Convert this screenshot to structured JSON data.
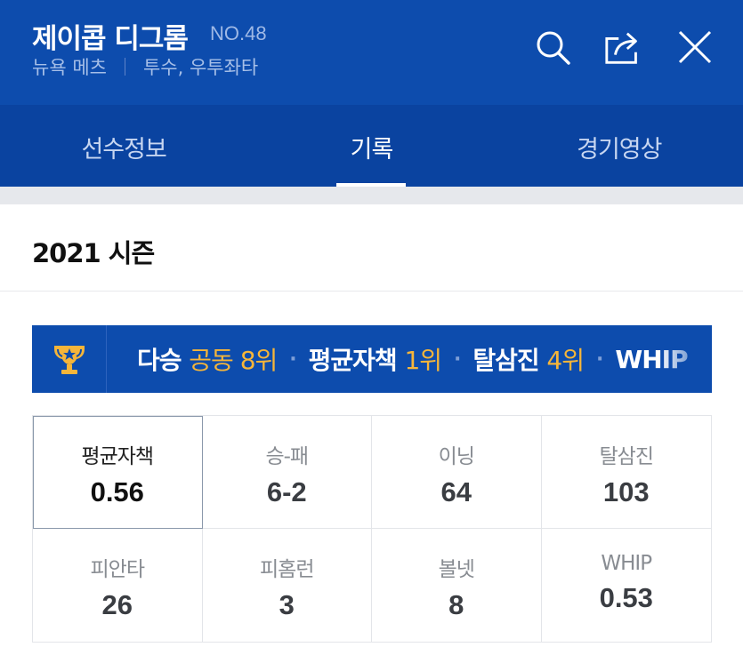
{
  "header": {
    "player_name": "제이콥 디그롬",
    "player_number": "NO.48",
    "team": "뉴욕 메츠",
    "position": "투수, 우투좌타",
    "icons": [
      "search-icon",
      "share-icon",
      "close-icon"
    ],
    "bg_color": "#0d4cad"
  },
  "tabs": [
    {
      "label": "선수정보",
      "active": false
    },
    {
      "label": "기록",
      "active": true
    },
    {
      "label": "경기영상",
      "active": false
    }
  ],
  "season": {
    "title": "2021 시즌"
  },
  "rank_bar": {
    "icon": "trophy-icon",
    "items": [
      {
        "label": "다승",
        "value": "공동 8위"
      },
      {
        "label": "평균자책",
        "value": "1위"
      },
      {
        "label": "탈삼진",
        "value": "4위"
      },
      {
        "label": "WHIP",
        "value": ""
      }
    ],
    "accent_color": "#f5b53a"
  },
  "stats": [
    {
      "label": "평균자책",
      "value": "0.56",
      "selected": true
    },
    {
      "label": "승-패",
      "value": "6-2"
    },
    {
      "label": "이닝",
      "value": "64"
    },
    {
      "label": "탈삼진",
      "value": "103"
    },
    {
      "label": "피안타",
      "value": "26"
    },
    {
      "label": "피홈런",
      "value": "3"
    },
    {
      "label": "볼넷",
      "value": "8"
    },
    {
      "label": "WHIP",
      "value": "0.53"
    }
  ]
}
